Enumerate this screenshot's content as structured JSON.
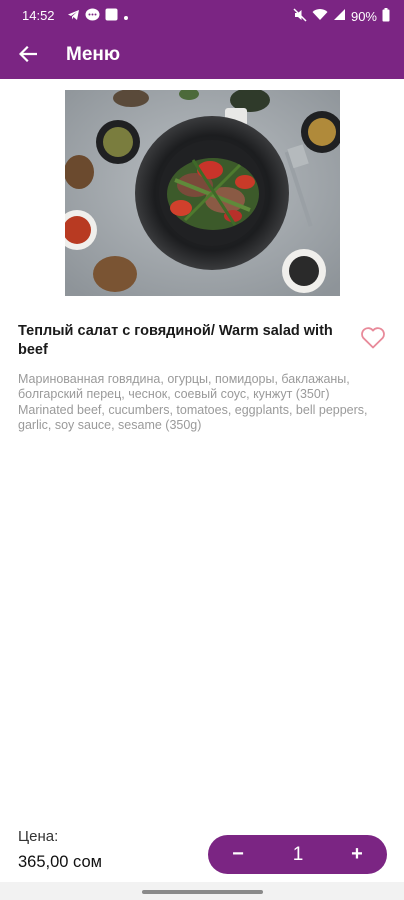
{
  "status_bar": {
    "time": "14:52",
    "notification_icons": [
      "telegram-icon",
      "chat-bubble-icon",
      "square-app-icon",
      "dot-icon"
    ],
    "system_icons": [
      "mute-icon",
      "wifi-icon",
      "signal-icon"
    ],
    "battery": "90%"
  },
  "app_bar": {
    "title": "Меню",
    "back_icon": "arrow-left-icon"
  },
  "product": {
    "image_icon": "dish-photo",
    "title": "Теплый салат с говядиной/ Warm salad with beef",
    "description": "Маринованная говядина, огурцы, помидоры, баклажаны, болгарский перец, чеснок, соевый соус, кунжут (350г)\nMarinated beef, cucumbers, tomatoes, eggplants, bell peppers, garlic, soy sauce, sesame (350g)",
    "favorite_icon": "heart-outline-icon"
  },
  "price": {
    "label": "Цена:",
    "value": "365,00 сом"
  },
  "quantity": {
    "minus_label": "−",
    "value": "1",
    "plus_label": "+"
  },
  "colors": {
    "brand": "#7b2583",
    "favorite": "#e88a9a",
    "description_text": "#9a9a9a"
  }
}
